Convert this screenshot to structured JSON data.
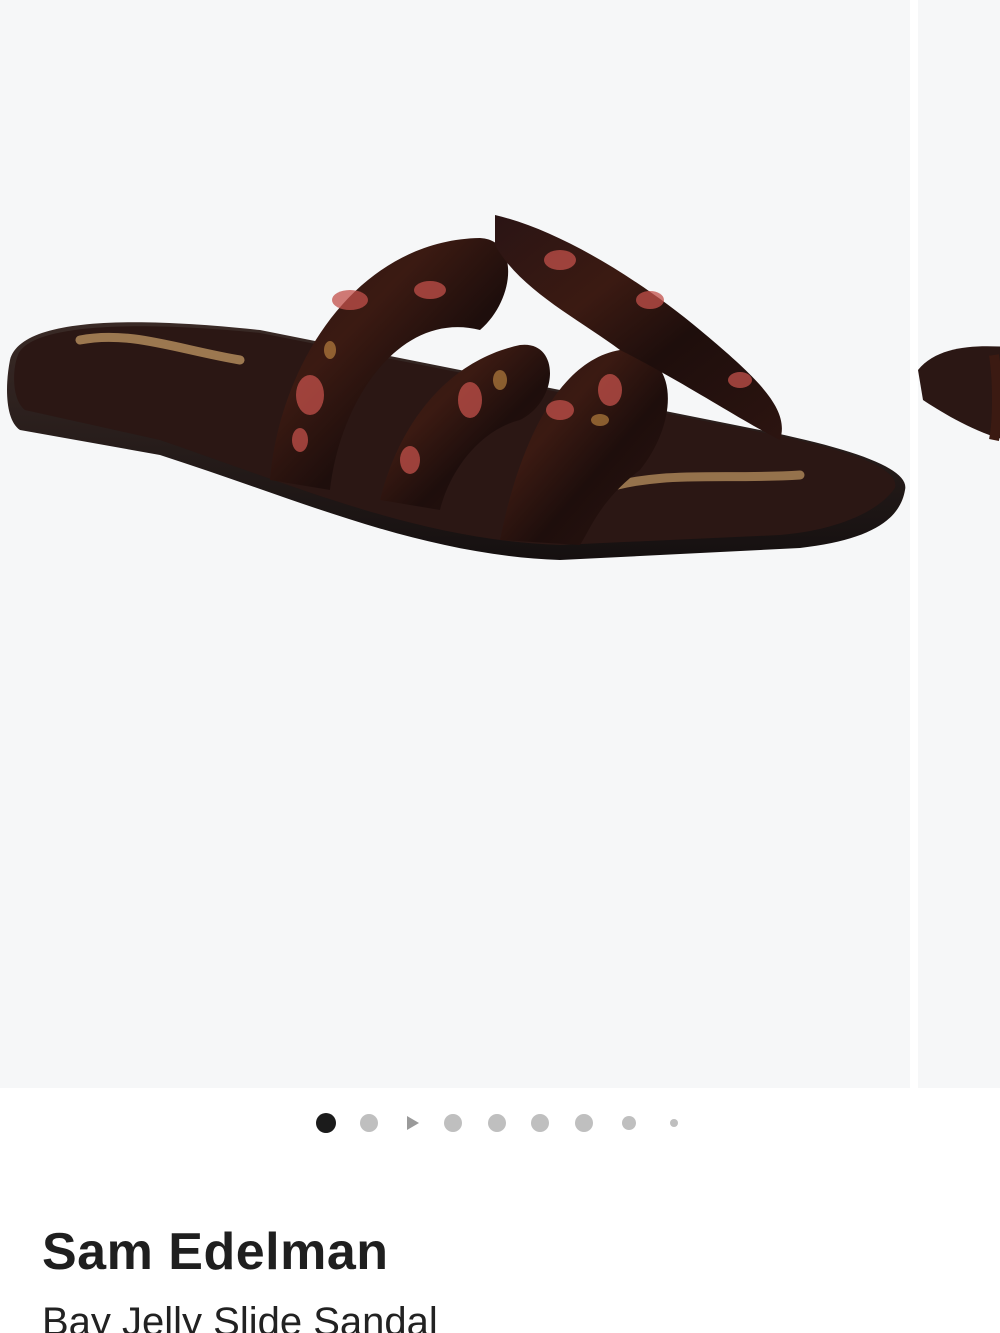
{
  "product": {
    "brand": "Sam Edelman",
    "name": "Bay Jelly Slide Sandal"
  },
  "gallery": {
    "image_label": "Sam Edelman Bay Jelly Slide Sandal, tortoise",
    "total_slides": 9,
    "active_index": 0,
    "indicators": [
      {
        "type": "dot",
        "state": "active"
      },
      {
        "type": "dot",
        "state": "inactive"
      },
      {
        "type": "video-play",
        "state": "inactive"
      },
      {
        "type": "dot",
        "state": "inactive"
      },
      {
        "type": "dot",
        "state": "inactive"
      },
      {
        "type": "dot",
        "state": "inactive"
      },
      {
        "type": "dot",
        "state": "inactive"
      },
      {
        "type": "dot",
        "state": "small"
      },
      {
        "type": "dot",
        "state": "tiny"
      }
    ]
  },
  "colors": {
    "image_background": "#f6f7f8",
    "dot_active": "#1b1b1b",
    "dot_inactive": "#bfbfbf",
    "text_primary": "#1f1f1f"
  },
  "icons": {
    "video_indicator": "play-icon"
  }
}
